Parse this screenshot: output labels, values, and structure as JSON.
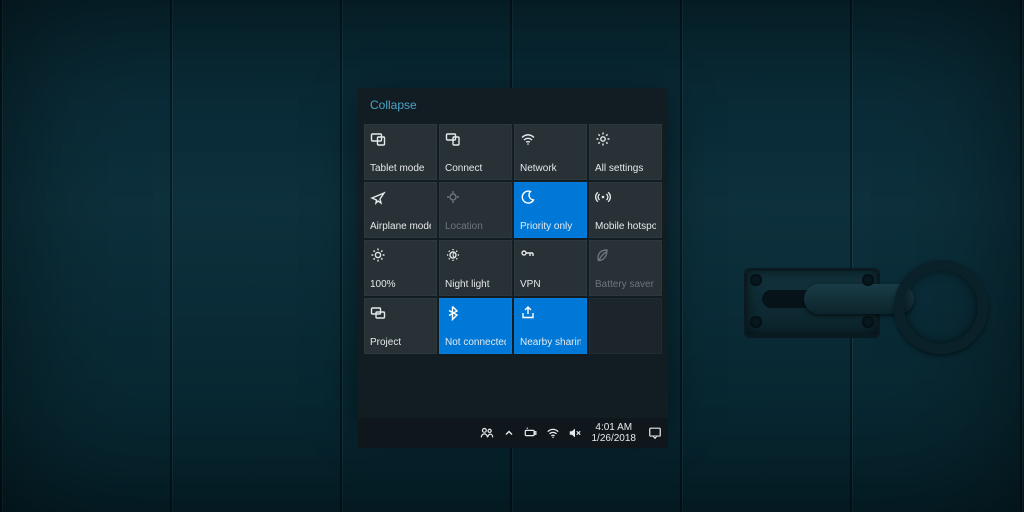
{
  "collapse_label": "Collapse",
  "tiles": [
    {
      "id": "tablet-mode",
      "label": "Tablet mode",
      "icon": "tablet",
      "state": "normal"
    },
    {
      "id": "connect",
      "label": "Connect",
      "icon": "connect",
      "state": "normal"
    },
    {
      "id": "network",
      "label": "Network",
      "icon": "wifi",
      "state": "normal"
    },
    {
      "id": "all-settings",
      "label": "All settings",
      "icon": "gear",
      "state": "normal"
    },
    {
      "id": "airplane-mode",
      "label": "Airplane mode",
      "icon": "airplane",
      "state": "normal"
    },
    {
      "id": "location",
      "label": "Location",
      "icon": "location",
      "state": "disabled"
    },
    {
      "id": "priority-only",
      "label": "Priority only",
      "icon": "moon",
      "state": "active"
    },
    {
      "id": "mobile-hotspot",
      "label": "Mobile hotspot",
      "icon": "hotspot",
      "state": "normal"
    },
    {
      "id": "brightness",
      "label": "100%",
      "icon": "brightness",
      "state": "normal"
    },
    {
      "id": "night-light",
      "label": "Night light",
      "icon": "nightlight",
      "state": "normal"
    },
    {
      "id": "vpn",
      "label": "VPN",
      "icon": "vpn",
      "state": "normal"
    },
    {
      "id": "battery-saver",
      "label": "Battery saver",
      "icon": "leaf",
      "state": "disabled"
    },
    {
      "id": "project",
      "label": "Project",
      "icon": "project",
      "state": "normal"
    },
    {
      "id": "bluetooth",
      "label": "Not connected",
      "icon": "bluetooth",
      "state": "active"
    },
    {
      "id": "nearby-sharing",
      "label": "Nearby sharing",
      "icon": "share",
      "state": "active"
    },
    {
      "id": "empty",
      "label": "",
      "icon": "",
      "state": "empty"
    }
  ],
  "taskbar": {
    "time": "4:01 AM",
    "date": "1/26/2018"
  },
  "colors": {
    "accent": "#0078d7",
    "panel_bg": "rgba(20,28,34,.92)",
    "link": "#4aa3c7"
  }
}
